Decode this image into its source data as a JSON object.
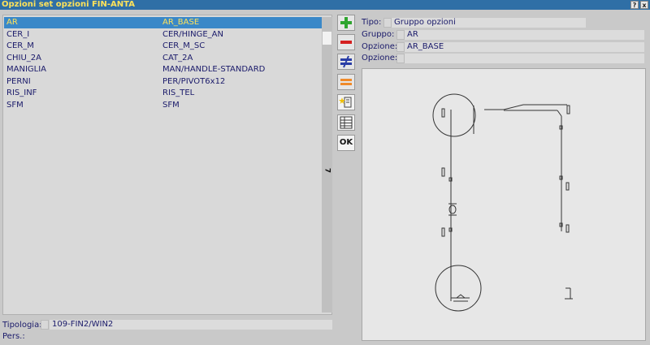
{
  "window": {
    "title": "Opzioni set opzioni FIN-ANTA",
    "help_label": "?",
    "close_label": "x"
  },
  "list": {
    "rows": [
      {
        "code": "AR",
        "value": "AR_BASE",
        "selected": true
      },
      {
        "code": "CER_I",
        "value": "CER/HINGE_AN"
      },
      {
        "code": "CER_M",
        "value": "CER_M_SC"
      },
      {
        "code": "CHIU_2A",
        "value": "CAT_2A"
      },
      {
        "code": "MANIGLIA",
        "value": "MAN/HANDLE-STANDARD"
      },
      {
        "code": "PERNI",
        "value": "PER/PIVOT6x12"
      },
      {
        "code": "RIS_INF",
        "value": "RIS_TEL"
      },
      {
        "code": "SFM",
        "value": "SFM"
      }
    ],
    "scroll_count": "7"
  },
  "toolbar": {
    "add_icon": "plus-icon",
    "remove_icon": "minus-icon",
    "not_equal_icon": "not-equal-icon",
    "equal_icon": "equal-icon",
    "ok_label": "OK",
    "colors": {
      "add": "#2fa52f",
      "remove": "#d42020",
      "not_equal": "#2a3ea6",
      "equal": "#f08a2a"
    }
  },
  "fields": {
    "tipo_label": "Tipo:",
    "tipo_value": "Gruppo opzioni",
    "gruppo_label": "Gruppo:",
    "gruppo_value": "AR",
    "opzione1_label": "Opzione:",
    "opzione1_value": "AR_BASE",
    "opzione2_label": "Opzione:",
    "opzione2_value": ""
  },
  "bottom": {
    "tipologia_label": "Tipologia:",
    "tipologia_value": "109-FIN2/WIN2",
    "pers_label": "Pers.:"
  },
  "colors": {
    "title_bg": "#2f6fa6",
    "title_text": "#ffe25a",
    "selection_bg": "#3a88c8",
    "text": "#1a1a6a"
  }
}
